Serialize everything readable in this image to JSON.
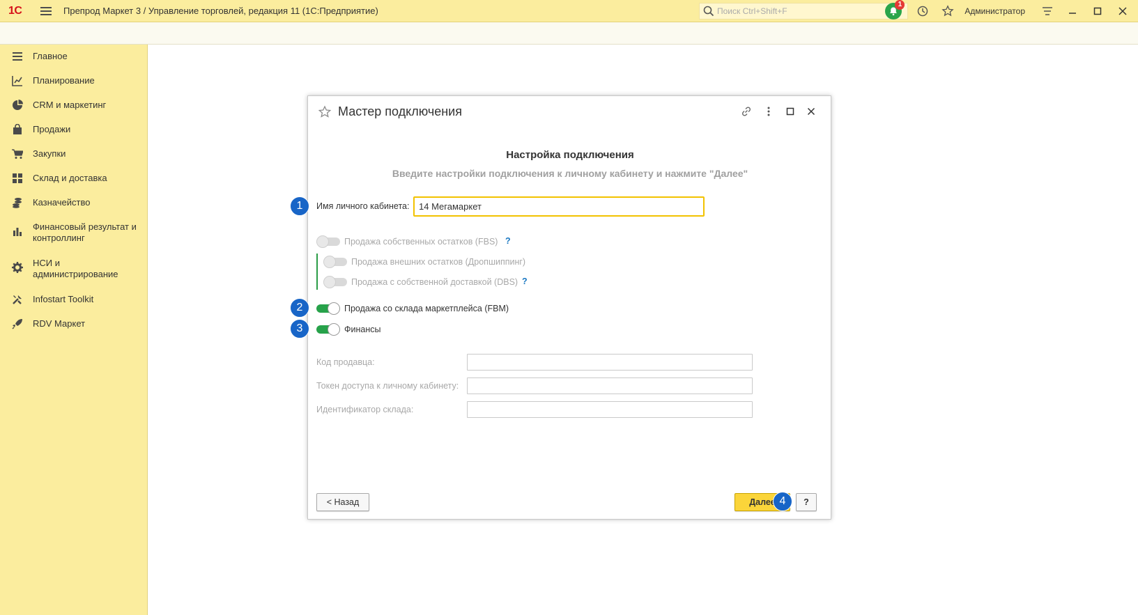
{
  "titlebar": {
    "logo": "1С",
    "title": "Препрод Маркет 3 / Управление торговлей, редакция 11  (1С:Предприятие)",
    "search_placeholder": "Поиск Ctrl+Shift+F",
    "notifications_count": "1",
    "username": "Администратор"
  },
  "sidebar": {
    "items": [
      {
        "label": "Главное",
        "icon": "menu-lines-icon"
      },
      {
        "label": "Планирование",
        "icon": "planning-icon"
      },
      {
        "label": "CRM и маркетинг",
        "icon": "pie-chart-icon"
      },
      {
        "label": "Продажи",
        "icon": "shopping-bag-icon"
      },
      {
        "label": "Закупки",
        "icon": "cart-icon"
      },
      {
        "label": "Склад и доставка",
        "icon": "warehouse-grid-icon"
      },
      {
        "label": "Казначейство",
        "icon": "coins-icon"
      },
      {
        "label": "Финансовый результат и контроллинг",
        "icon": "bar-chart-icon"
      },
      {
        "label": "НСИ и администрирование",
        "icon": "gear-icon"
      },
      {
        "label": "Infostart Toolkit",
        "icon": "tools-icon"
      },
      {
        "label": "RDV Маркет",
        "icon": "rocket-icon"
      }
    ]
  },
  "dialog": {
    "title": "Мастер подключения",
    "heading": "Настройка подключения",
    "subheading": "Введите настройки подключения к личному кабинету и нажмите \"Далее\"",
    "cabinet_name_label": "Имя личного кабинета:",
    "cabinet_name_value": "14 Мегамаркет",
    "toggles": {
      "fbs": {
        "label": "Продажа собственных остатков (FBS)",
        "help": "?",
        "on": false
      },
      "dropship": {
        "label": "Продажа внешних остатков (Дропшиппинг)",
        "on": false
      },
      "dbs": {
        "label": "Продажа с собственной доставкой (DBS)",
        "help": "?",
        "on": false
      },
      "fbm": {
        "label": "Продажа со склада маркетплейса (FBM)",
        "on": true
      },
      "finance": {
        "label": "Финансы",
        "on": true
      }
    },
    "fields": {
      "seller_code_label": "Код продавца:",
      "token_label": "Токен доступа к личному кабинету:",
      "warehouse_id_label": "Идентификатор склада:"
    },
    "buttons": {
      "back": "< Назад",
      "next": "Далее",
      "help": "?"
    },
    "markers": [
      "1",
      "2",
      "3",
      "4"
    ]
  },
  "colors": {
    "panel_yellow": "#fbed9e",
    "accent_yellow": "#fbd53a",
    "toggle_green": "#27a24a",
    "marker_blue": "#1865c7",
    "logo_red": "#d6131b"
  }
}
